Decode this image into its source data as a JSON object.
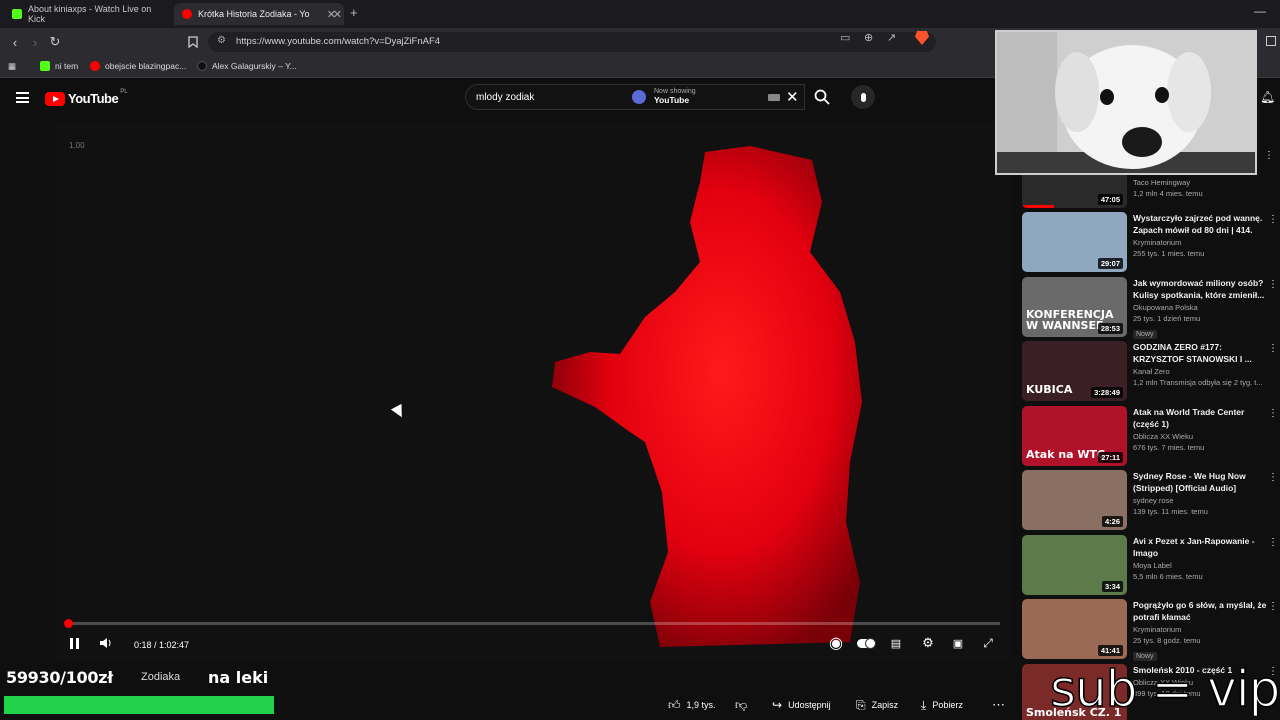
{
  "browser": {
    "tabs": [
      {
        "title": "About kiniaxps - Watch Live on Kick",
        "favicon_color": "#53fc18"
      },
      {
        "title": "Krótka Historia Zodiaka - You",
        "favicon_color": "#ff0000"
      }
    ],
    "url": "https://www.youtube.com/watch?v=DyajZiFnAF4",
    "bookmarks": [
      {
        "label": "ni tem",
        "color": "#53fc18"
      },
      {
        "label": "obejscie blazingpac...",
        "color": "#ff0000"
      },
      {
        "label": "Alex Galagurskiy – Y...",
        "color": "#333333"
      }
    ]
  },
  "youtube": {
    "logo_text": "YouTube",
    "country": "PL",
    "search_query": "mlody zodiak",
    "now_showing_label": "Now showing",
    "now_showing_value": "YouTube"
  },
  "player": {
    "corner_label": "1.00",
    "current_time": "0:18",
    "duration": "1:02:47",
    "time_display": "0:18 / 1:02:47",
    "progress_fraction": 0.005
  },
  "overlay": {
    "goal_text": "59930/100zł",
    "title_fragment": "Zodiaka",
    "goal_suffix": "na leki",
    "goal_fill_fraction": 1.0,
    "watermark": "sub = vip"
  },
  "actions": {
    "likes": "1,9 tys.",
    "share": "Udostępnij",
    "save": "Zapisz",
    "download": "Pobierz"
  },
  "sidebar": {
    "partial_top": {
      "channel": "Taco Hemingway",
      "stats": "1,2 mln  4 mies. temu",
      "duration": "47:05"
    },
    "videos": [
      {
        "title": "Wystarczyło zajrzeć pod wannę. Zapach mówił od 80 dni | 414.",
        "channel": "Kryminatorium",
        "stats": "255 tys.  1 mies. temu",
        "duration": "29:07",
        "badge": "",
        "thumb_text": "",
        "thumb_color": "#8fa8c0"
      },
      {
        "title": "Jak wymordować miliony osób? Kulisy spotkania, które zmienił...",
        "channel": "Okupowana Polska",
        "stats": "25 tys.  1 dzień temu",
        "duration": "28:53",
        "badge": "Nowy",
        "thumb_text": "KONFERENCJA W WANNSEE",
        "thumb_color": "#6a6a6a"
      },
      {
        "title": "GODZINA ZERO #177: KRZYSZTOF STANOWSKI I ...",
        "channel": "Kanał Zero",
        "stats": "1,2 mln  Transmisja odbyła się 2 tyg. t...",
        "duration": "3:28:49",
        "badge": "",
        "thumb_text": "KUBICA",
        "thumb_color": "#3a1f24"
      },
      {
        "title": "Atak na World Trade Center (część 1)",
        "channel": "Oblicza XX Wieku",
        "stats": "676 tys.  7 mies. temu",
        "duration": "27:11",
        "badge": "",
        "thumb_text": "Atak na WTC",
        "thumb_color": "#b0122a"
      },
      {
        "title": "Sydney Rose - We Hug Now (Stripped) [Official Audio]",
        "channel": "sydney rose",
        "stats": "139 tys.  11 mies. temu",
        "duration": "4:26",
        "badge": "",
        "thumb_text": "",
        "thumb_color": "#8a6f63"
      },
      {
        "title": "Avi x Pezet x Jan-Rapowanie - Imago",
        "channel": "Moya Label",
        "stats": "5,5 mln  6 mies. temu",
        "duration": "3:34",
        "badge": "",
        "thumb_text": "",
        "thumb_color": "#5d7a4a"
      },
      {
        "title": "Pogrążyło go 6 słów, a myślał, że potrafi kłamać",
        "channel": "Kryminatorium",
        "stats": "25 tys.  8 godz. temu",
        "duration": "41:41",
        "badge": "Nowy",
        "thumb_text": "",
        "thumb_color": "#9a6a55"
      },
      {
        "title": "Smoleńsk 2010 - część 1",
        "channel": "Oblicza XX Wieku",
        "stats": "399 tys.  10 dni temu",
        "duration": "",
        "badge": "",
        "thumb_text": "Smoleńsk CZ. 1",
        "thumb_color": "#7b2a2a"
      }
    ]
  },
  "colors": {
    "accent": "#ff0000",
    "goal_green": "#22d14a",
    "figure_red": "#e3000f"
  }
}
